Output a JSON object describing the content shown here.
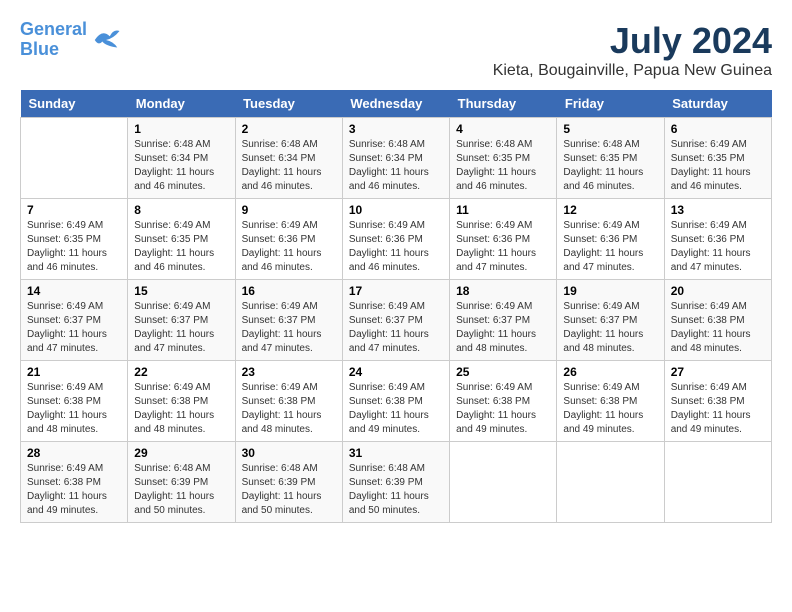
{
  "header": {
    "logo_line1": "General",
    "logo_line2": "Blue",
    "main_title": "July 2024",
    "subtitle": "Kieta, Bougainville, Papua New Guinea"
  },
  "calendar": {
    "days_of_week": [
      "Sunday",
      "Monday",
      "Tuesday",
      "Wednesday",
      "Thursday",
      "Friday",
      "Saturday"
    ],
    "weeks": [
      [
        {
          "day": "",
          "sunrise": "",
          "sunset": "",
          "daylight": ""
        },
        {
          "day": "1",
          "sunrise": "Sunrise: 6:48 AM",
          "sunset": "Sunset: 6:34 PM",
          "daylight": "Daylight: 11 hours and 46 minutes."
        },
        {
          "day": "2",
          "sunrise": "Sunrise: 6:48 AM",
          "sunset": "Sunset: 6:34 PM",
          "daylight": "Daylight: 11 hours and 46 minutes."
        },
        {
          "day": "3",
          "sunrise": "Sunrise: 6:48 AM",
          "sunset": "Sunset: 6:34 PM",
          "daylight": "Daylight: 11 hours and 46 minutes."
        },
        {
          "day": "4",
          "sunrise": "Sunrise: 6:48 AM",
          "sunset": "Sunset: 6:35 PM",
          "daylight": "Daylight: 11 hours and 46 minutes."
        },
        {
          "day": "5",
          "sunrise": "Sunrise: 6:48 AM",
          "sunset": "Sunset: 6:35 PM",
          "daylight": "Daylight: 11 hours and 46 minutes."
        },
        {
          "day": "6",
          "sunrise": "Sunrise: 6:49 AM",
          "sunset": "Sunset: 6:35 PM",
          "daylight": "Daylight: 11 hours and 46 minutes."
        }
      ],
      [
        {
          "day": "7",
          "sunrise": "Sunrise: 6:49 AM",
          "sunset": "Sunset: 6:35 PM",
          "daylight": "Daylight: 11 hours and 46 minutes."
        },
        {
          "day": "8",
          "sunrise": "Sunrise: 6:49 AM",
          "sunset": "Sunset: 6:35 PM",
          "daylight": "Daylight: 11 hours and 46 minutes."
        },
        {
          "day": "9",
          "sunrise": "Sunrise: 6:49 AM",
          "sunset": "Sunset: 6:36 PM",
          "daylight": "Daylight: 11 hours and 46 minutes."
        },
        {
          "day": "10",
          "sunrise": "Sunrise: 6:49 AM",
          "sunset": "Sunset: 6:36 PM",
          "daylight": "Daylight: 11 hours and 46 minutes."
        },
        {
          "day": "11",
          "sunrise": "Sunrise: 6:49 AM",
          "sunset": "Sunset: 6:36 PM",
          "daylight": "Daylight: 11 hours and 47 minutes."
        },
        {
          "day": "12",
          "sunrise": "Sunrise: 6:49 AM",
          "sunset": "Sunset: 6:36 PM",
          "daylight": "Daylight: 11 hours and 47 minutes."
        },
        {
          "day": "13",
          "sunrise": "Sunrise: 6:49 AM",
          "sunset": "Sunset: 6:36 PM",
          "daylight": "Daylight: 11 hours and 47 minutes."
        }
      ],
      [
        {
          "day": "14",
          "sunrise": "Sunrise: 6:49 AM",
          "sunset": "Sunset: 6:37 PM",
          "daylight": "Daylight: 11 hours and 47 minutes."
        },
        {
          "day": "15",
          "sunrise": "Sunrise: 6:49 AM",
          "sunset": "Sunset: 6:37 PM",
          "daylight": "Daylight: 11 hours and 47 minutes."
        },
        {
          "day": "16",
          "sunrise": "Sunrise: 6:49 AM",
          "sunset": "Sunset: 6:37 PM",
          "daylight": "Daylight: 11 hours and 47 minutes."
        },
        {
          "day": "17",
          "sunrise": "Sunrise: 6:49 AM",
          "sunset": "Sunset: 6:37 PM",
          "daylight": "Daylight: 11 hours and 47 minutes."
        },
        {
          "day": "18",
          "sunrise": "Sunrise: 6:49 AM",
          "sunset": "Sunset: 6:37 PM",
          "daylight": "Daylight: 11 hours and 48 minutes."
        },
        {
          "day": "19",
          "sunrise": "Sunrise: 6:49 AM",
          "sunset": "Sunset: 6:37 PM",
          "daylight": "Daylight: 11 hours and 48 minutes."
        },
        {
          "day": "20",
          "sunrise": "Sunrise: 6:49 AM",
          "sunset": "Sunset: 6:38 PM",
          "daylight": "Daylight: 11 hours and 48 minutes."
        }
      ],
      [
        {
          "day": "21",
          "sunrise": "Sunrise: 6:49 AM",
          "sunset": "Sunset: 6:38 PM",
          "daylight": "Daylight: 11 hours and 48 minutes."
        },
        {
          "day": "22",
          "sunrise": "Sunrise: 6:49 AM",
          "sunset": "Sunset: 6:38 PM",
          "daylight": "Daylight: 11 hours and 48 minutes."
        },
        {
          "day": "23",
          "sunrise": "Sunrise: 6:49 AM",
          "sunset": "Sunset: 6:38 PM",
          "daylight": "Daylight: 11 hours and 48 minutes."
        },
        {
          "day": "24",
          "sunrise": "Sunrise: 6:49 AM",
          "sunset": "Sunset: 6:38 PM",
          "daylight": "Daylight: 11 hours and 49 minutes."
        },
        {
          "day": "25",
          "sunrise": "Sunrise: 6:49 AM",
          "sunset": "Sunset: 6:38 PM",
          "daylight": "Daylight: 11 hours and 49 minutes."
        },
        {
          "day": "26",
          "sunrise": "Sunrise: 6:49 AM",
          "sunset": "Sunset: 6:38 PM",
          "daylight": "Daylight: 11 hours and 49 minutes."
        },
        {
          "day": "27",
          "sunrise": "Sunrise: 6:49 AM",
          "sunset": "Sunset: 6:38 PM",
          "daylight": "Daylight: 11 hours and 49 minutes."
        }
      ],
      [
        {
          "day": "28",
          "sunrise": "Sunrise: 6:49 AM",
          "sunset": "Sunset: 6:38 PM",
          "daylight": "Daylight: 11 hours and 49 minutes."
        },
        {
          "day": "29",
          "sunrise": "Sunrise: 6:48 AM",
          "sunset": "Sunset: 6:39 PM",
          "daylight": "Daylight: 11 hours and 50 minutes."
        },
        {
          "day": "30",
          "sunrise": "Sunrise: 6:48 AM",
          "sunset": "Sunset: 6:39 PM",
          "daylight": "Daylight: 11 hours and 50 minutes."
        },
        {
          "day": "31",
          "sunrise": "Sunrise: 6:48 AM",
          "sunset": "Sunset: 6:39 PM",
          "daylight": "Daylight: 11 hours and 50 minutes."
        },
        {
          "day": "",
          "sunrise": "",
          "sunset": "",
          "daylight": ""
        },
        {
          "day": "",
          "sunrise": "",
          "sunset": "",
          "daylight": ""
        },
        {
          "day": "",
          "sunrise": "",
          "sunset": "",
          "daylight": ""
        }
      ]
    ]
  }
}
